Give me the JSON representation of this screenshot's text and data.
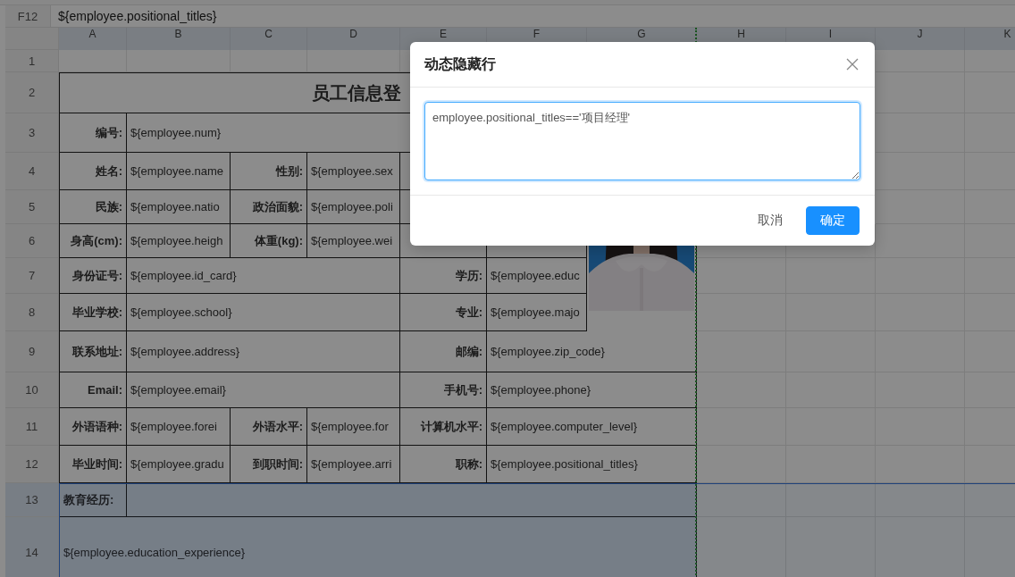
{
  "formula_bar": {
    "name_box": "F12",
    "formula": "${employee.positional_titles}"
  },
  "sheet": {
    "columns": [
      "A",
      "B",
      "C",
      "D",
      "E",
      "F",
      "G",
      "H",
      "I",
      "J",
      "K"
    ],
    "rows": [
      {
        "number": "1",
        "selected": false
      },
      {
        "number": "2",
        "selected": false,
        "cells": [
          {
            "kind": "title",
            "text": "员工信息登"
          }
        ]
      },
      {
        "number": "3",
        "selected": false,
        "cells": [
          {
            "kind": "label",
            "text": "编号:"
          },
          {
            "kind": "value",
            "text": "${employee.num}"
          }
        ]
      },
      {
        "number": "4",
        "selected": false,
        "cells": [
          {
            "kind": "label",
            "text": "姓名:"
          },
          {
            "kind": "value",
            "text": "${employee.name"
          },
          {
            "kind": "label",
            "text": "性别:"
          },
          {
            "kind": "value",
            "text": "${employee.sex"
          }
        ]
      },
      {
        "number": "5",
        "selected": false,
        "cells": [
          {
            "kind": "label",
            "text": "民族:"
          },
          {
            "kind": "value",
            "text": "${employee.natio"
          },
          {
            "kind": "label",
            "text": "政治面貌:"
          },
          {
            "kind": "value",
            "text": "${employee.poli"
          }
        ]
      },
      {
        "number": "6",
        "selected": false,
        "cells": [
          {
            "kind": "label",
            "text": "身高(cm):"
          },
          {
            "kind": "value",
            "text": "${employee.heigh"
          },
          {
            "kind": "label",
            "text": "体重(kg):"
          },
          {
            "kind": "value",
            "text": "${employee.wei"
          }
        ]
      },
      {
        "number": "7",
        "selected": false,
        "cells": [
          {
            "kind": "label",
            "text": "身份证号:"
          },
          {
            "kind": "value",
            "text": "${employee.id_card}"
          },
          {
            "kind": "label",
            "text": "学历:"
          },
          {
            "kind": "value",
            "text": "${employee.educ"
          }
        ]
      },
      {
        "number": "8",
        "selected": false,
        "cells": [
          {
            "kind": "label",
            "text": "毕业学校:"
          },
          {
            "kind": "value",
            "text": "${employee.school}"
          },
          {
            "kind": "label",
            "text": "专业:"
          },
          {
            "kind": "value",
            "text": "${employee.majo"
          }
        ]
      },
      {
        "number": "9",
        "selected": false,
        "cells": [
          {
            "kind": "label",
            "text": "联系地址:"
          },
          {
            "kind": "value",
            "text": "${employee.address}"
          },
          {
            "kind": "label",
            "text": "邮编:"
          },
          {
            "kind": "value",
            "text": "${employee.zip_code}"
          }
        ]
      },
      {
        "number": "10",
        "selected": false,
        "cells": [
          {
            "kind": "label",
            "text": "Email:"
          },
          {
            "kind": "value",
            "text": "${employee.email}"
          },
          {
            "kind": "label",
            "text": "手机号:"
          },
          {
            "kind": "value",
            "text": "${employee.phone}"
          }
        ]
      },
      {
        "number": "11",
        "selected": false,
        "cells": [
          {
            "kind": "label",
            "text": "外语语种:"
          },
          {
            "kind": "value",
            "text": "${employee.forei"
          },
          {
            "kind": "label",
            "text": "外语水平:"
          },
          {
            "kind": "value",
            "text": "${employee.for"
          },
          {
            "kind": "label",
            "text": "计算机水平:"
          },
          {
            "kind": "value",
            "text": "${employee.computer_level}"
          }
        ]
      },
      {
        "number": "12",
        "selected": false,
        "cells": [
          {
            "kind": "label",
            "text": "毕业时间:"
          },
          {
            "kind": "value",
            "text": "${employee.gradu"
          },
          {
            "kind": "label",
            "text": "到职时间:"
          },
          {
            "kind": "value",
            "text": "${employee.arri"
          },
          {
            "kind": "label",
            "text": "职称:"
          },
          {
            "kind": "value",
            "text": "${employee.positional_titles}"
          }
        ]
      },
      {
        "number": "13",
        "selected": true,
        "cells": [
          {
            "kind": "section",
            "text": "教育经历:"
          }
        ]
      },
      {
        "number": "14",
        "selected": true,
        "cells": [
          {
            "kind": "value",
            "text": "${employee.education_experience}"
          }
        ]
      }
    ]
  },
  "dialog": {
    "title": "动态隐藏行",
    "expression": "employee.positional_titles=='项目经理'",
    "buttons": [
      {
        "label": "取消",
        "kind": "default"
      },
      {
        "label": "确定",
        "kind": "primary"
      }
    ]
  }
}
